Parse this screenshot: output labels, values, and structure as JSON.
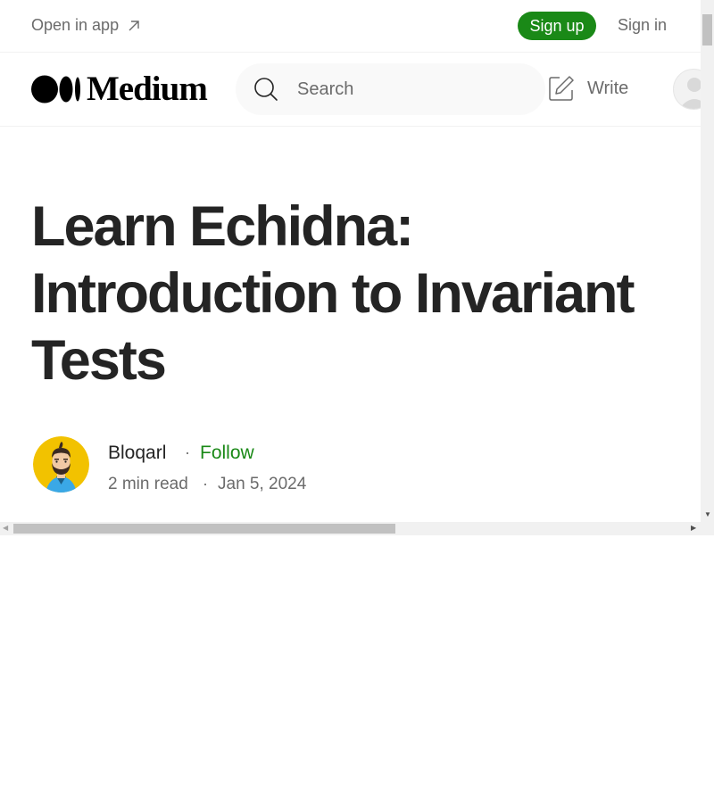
{
  "banner": {
    "open_in_app": "Open in app",
    "sign_up": "Sign up",
    "sign_in": "Sign in"
  },
  "header": {
    "logo_text": "Medium",
    "search_placeholder": "Search",
    "write_label": "Write"
  },
  "article": {
    "title": "Learn Echidna: Introduction to Invariant Tests",
    "author": "Bloqarl",
    "separator": "·",
    "follow_label": "Follow",
    "read_time": "2 min read",
    "date": "Jan 5, 2024"
  },
  "icons": {
    "open_in_app": "arrow-up-right-icon",
    "search": "search-icon",
    "write": "write-icon"
  },
  "colors": {
    "brand_green": "#1a8917",
    "text": "#242424",
    "muted": "#6b6b6b",
    "avatar_bg": "#f2c200"
  }
}
